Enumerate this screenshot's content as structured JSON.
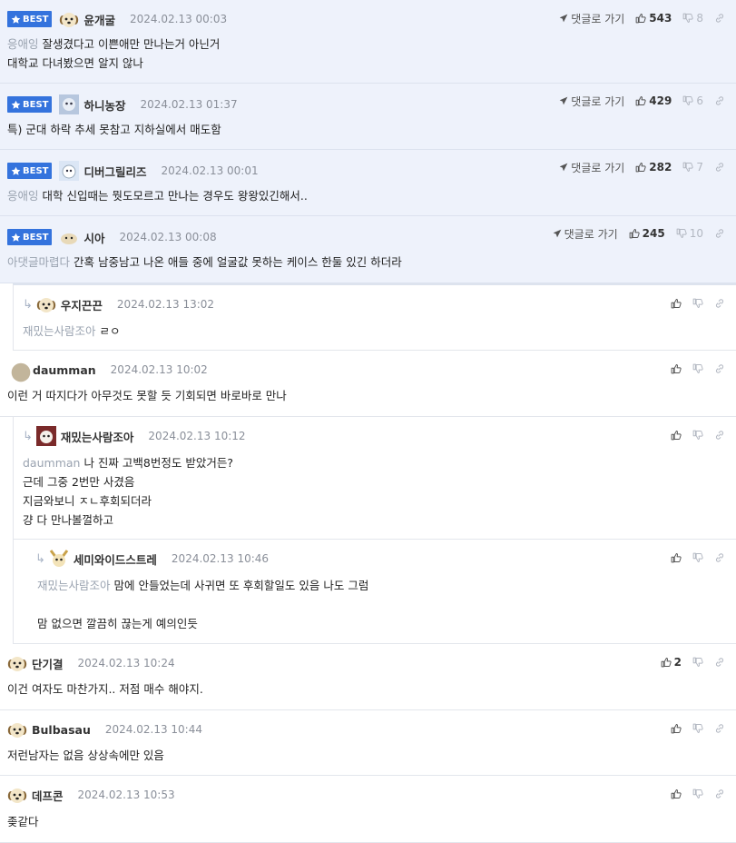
{
  "badge_label": "BEST",
  "goto_label": "댓글로 가기",
  "comments": [
    {
      "nick": "윤개굴",
      "date": "2024.02.13 00:03",
      "mention": "응애잉",
      "text": "잘생겼다고 이쁜애만 만나는거 아닌거\n대학교 다녀봤으면 알지 않나",
      "up": "543",
      "down": "8"
    },
    {
      "nick": "하니농장",
      "date": "2024.02.13 01:37",
      "mention": "",
      "text": "특) 군대 하락 추세 못참고 지하실에서 매도함",
      "up": "429",
      "down": "6"
    },
    {
      "nick": "디버그릴리즈",
      "date": "2024.02.13 00:01",
      "mention": "응애잉",
      "text": "대학 신입때는 뭣도모르고 만나는 경우도 왕왕있긴해서..",
      "up": "282",
      "down": "7"
    },
    {
      "nick": "시아",
      "date": "2024.02.13 00:08",
      "mention": "아댓글마렵다",
      "text": "간혹 남중남고 나온 애들 중에 얼굴값 못하는 케이스 한둘 있긴 하더라",
      "up": "245",
      "down": "10"
    },
    {
      "nick": "우지끈끈",
      "date": "2024.02.13 13:02",
      "mention": "재밌는사람조아",
      "text": "ㄹㅇ",
      "up": "",
      "down": ""
    },
    {
      "nick": "daumman",
      "date": "2024.02.13 10:02",
      "mention": "",
      "text": "이런 거 따지다가 아무것도 못할 듯 기회되면 바로바로 만나",
      "up": "",
      "down": ""
    },
    {
      "nick": "재밌는사람조아",
      "date": "2024.02.13 10:12",
      "mention": "daumman",
      "text": "나 진짜 고백8번정도 받았거든?\n근데 그중 2번만 사겼음\n지금와보니 ㅈㄴ후회되더라\n걍 다 만나볼껄하고",
      "up": "",
      "down": ""
    },
    {
      "nick": "세미와이드스트레",
      "date": "2024.02.13 10:46",
      "mention": "재밌는사람조아",
      "text": "맘에 안들었는데 사귀면 또 후회할일도 있음 나도 그럼\n\n맘 없으면 깔끔히 끊는게 예의인듯",
      "up": "",
      "down": ""
    },
    {
      "nick": "단기결",
      "date": "2024.02.13 10:24",
      "mention": "",
      "text": "이건 여자도 마찬가지.. 저점 매수 해야지.",
      "up": "2",
      "down": ""
    },
    {
      "nick": "Bulbasau",
      "date": "2024.02.13 10:44",
      "mention": "",
      "text": "저런남자는 없음 상상속에만 있음",
      "up": "",
      "down": ""
    },
    {
      "nick": "데프콘",
      "date": "2024.02.13 10:53",
      "mention": "",
      "text": "좆같다",
      "up": "",
      "down": ""
    }
  ]
}
